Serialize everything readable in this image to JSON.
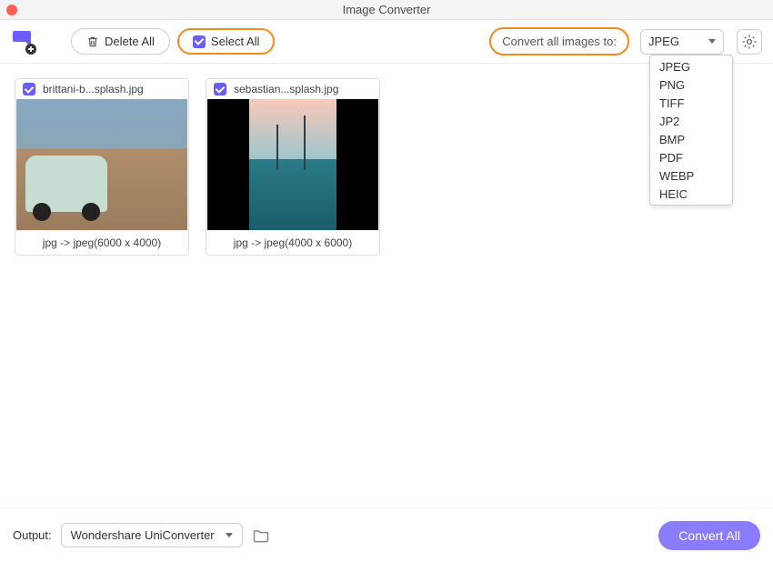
{
  "window": {
    "title": "Image Converter"
  },
  "toolbar": {
    "delete_all_label": "Delete All",
    "select_all_label": "Select All",
    "convert_to_label": "Convert all images to:",
    "format_selected": "JPEG"
  },
  "format_options": [
    "JPEG",
    "PNG",
    "TIFF",
    "JP2",
    "BMP",
    "PDF",
    "WEBP",
    "HEIC"
  ],
  "images": [
    {
      "filename": "brittani-b...splash.jpg",
      "conversion": "jpg -> jpeg(6000 x 4000)"
    },
    {
      "filename": "sebastian...splash.jpg",
      "conversion": "jpg -> jpeg(4000 x 6000)"
    }
  ],
  "output": {
    "label": "Output:",
    "destination": "Wondershare UniConverter"
  },
  "actions": {
    "convert_all_label": "Convert All"
  }
}
